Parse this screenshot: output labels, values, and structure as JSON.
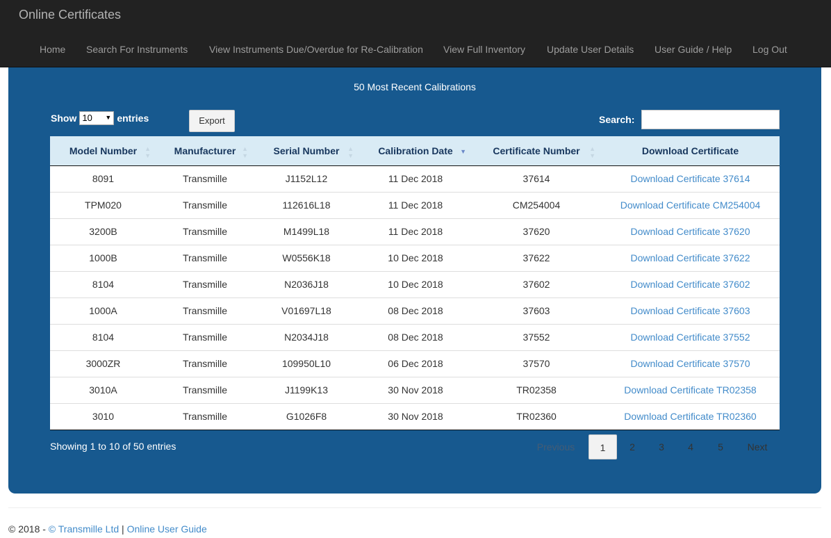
{
  "brand": "Online Certificates",
  "nav": [
    {
      "label": "Home"
    },
    {
      "label": "Search For Instruments"
    },
    {
      "label": "View Instruments Due/Overdue for Re-Calibration"
    },
    {
      "label": "View Full Inventory"
    },
    {
      "label": "Update User Details"
    },
    {
      "label": "User Guide / Help"
    },
    {
      "label": "Log Out"
    }
  ],
  "panel": {
    "title": "50 Most Recent Calibrations",
    "show_label": "Show",
    "entries_value": "10",
    "entries_label": "entries",
    "export_label": "Export",
    "search_label": "Search:",
    "search_value": ""
  },
  "table": {
    "columns": [
      "Model Number",
      "Manufacturer",
      "Serial Number",
      "Calibration Date",
      "Certificate Number",
      "Download Certificate"
    ],
    "rows": [
      [
        "8091",
        "Transmille",
        "J1152L12",
        "11 Dec 2018",
        "37614",
        "Download Certificate 37614"
      ],
      [
        "TPM020",
        "Transmille",
        "112616L18",
        "11 Dec 2018",
        "CM254004",
        "Download Certificate CM254004"
      ],
      [
        "3200B",
        "Transmille",
        "M1499L18",
        "11 Dec 2018",
        "37620",
        "Download Certificate 37620"
      ],
      [
        "1000B",
        "Transmille",
        "W0556K18",
        "10 Dec 2018",
        "37622",
        "Download Certificate 37622"
      ],
      [
        "8104",
        "Transmille",
        "N2036J18",
        "10 Dec 2018",
        "37602",
        "Download Certificate 37602"
      ],
      [
        "1000A",
        "Transmille",
        "V01697L18",
        "08 Dec 2018",
        "37603",
        "Download Certificate 37603"
      ],
      [
        "8104",
        "Transmille",
        "N2034J18",
        "08 Dec 2018",
        "37552",
        "Download Certificate 37552"
      ],
      [
        "3000ZR",
        "Transmille",
        "109950L10",
        "06 Dec 2018",
        "37570",
        "Download Certificate 37570"
      ],
      [
        "3010A",
        "Transmille",
        "J1199K13",
        "30 Nov 2018",
        "TR02358",
        "Download Certificate TR02358"
      ],
      [
        "3010",
        "Transmille",
        "G1026F8",
        "30 Nov 2018",
        "TR02360",
        "Download Certificate TR02360"
      ]
    ]
  },
  "pagination": {
    "info": "Showing 1 to 10 of 50 entries",
    "previous": "Previous",
    "pages": [
      "1",
      "2",
      "3",
      "4",
      "5"
    ],
    "current": "1",
    "next": "Next"
  },
  "footer": {
    "prefix": "© 2018 - ",
    "company_link": "© Transmille Ltd",
    "separator": " | ",
    "guide_link": "Online User Guide"
  },
  "colors": {
    "navbar": "#222222",
    "panel": "#17598f",
    "header_row": "#d9ebf5",
    "link": "#428bca"
  }
}
